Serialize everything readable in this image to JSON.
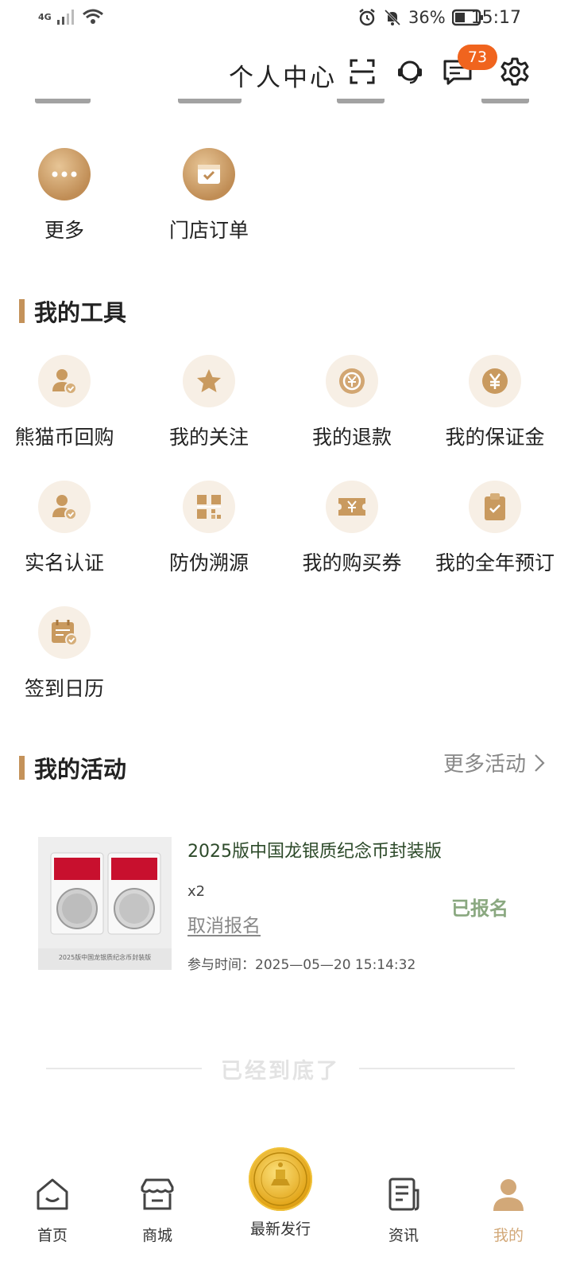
{
  "status_bar": {
    "network": "4G",
    "battery": "36%",
    "time": "15:17"
  },
  "header": {
    "title": "个人中心",
    "message_badge": "73"
  },
  "top_items": [
    {
      "label": "更多",
      "icon": "more-dots-icon"
    },
    {
      "label": "门店订单",
      "icon": "store-order-icon"
    }
  ],
  "tools": {
    "title": "我的工具",
    "items": [
      {
        "label": "熊猫币回购",
        "icon": "user-check-icon"
      },
      {
        "label": "我的关注",
        "icon": "star-icon"
      },
      {
        "label": "我的退款",
        "icon": "refund-icon"
      },
      {
        "label": "我的保证金",
        "icon": "yen-coin-icon"
      },
      {
        "label": "实名认证",
        "icon": "id-verify-icon"
      },
      {
        "label": "防伪溯源",
        "icon": "qr-code-icon"
      },
      {
        "label": "我的购买券",
        "icon": "coupon-icon"
      },
      {
        "label": "我的全年预订",
        "icon": "clipboard-check-icon"
      },
      {
        "label": "签到日历",
        "icon": "calendar-check-icon"
      }
    ]
  },
  "activities": {
    "title": "我的活动",
    "more_label": "更多活动",
    "card": {
      "title": "2025版中国龙银质纪念币封装版",
      "qty": "x2",
      "cancel_label": "取消报名",
      "status": "已报名",
      "time": "参与时间：2025—05—20 15:14:32",
      "image_caption": "2025版中国龙银质纪念币封装版"
    }
  },
  "bottom_text": "已经到底了",
  "tabbar": {
    "home": "首页",
    "mall": "商城",
    "new_release": "最新发行",
    "news": "资讯",
    "mine": "我的"
  },
  "colors": {
    "accent": "#c4925a",
    "badge": "#f0641e",
    "active_tab": "#d2a878"
  }
}
